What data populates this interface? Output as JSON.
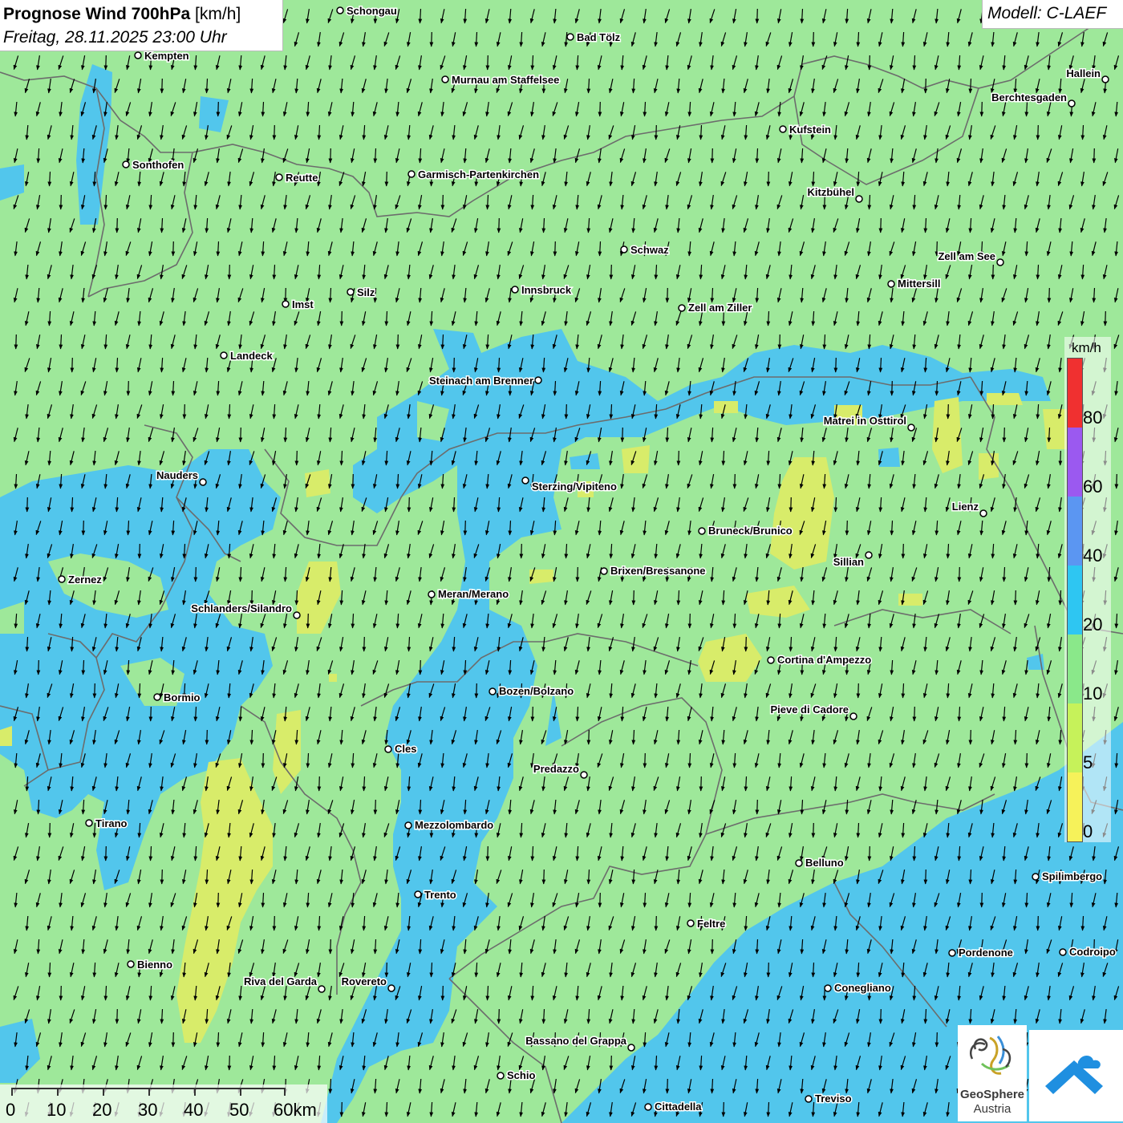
{
  "header": {
    "title_bold": "Prognose Wind 700hPa",
    "title_unit": "[km/h]",
    "datetime": "Freitag, 28.11.2025 23:00 Uhr"
  },
  "model": {
    "label": "Modell: C-LAEF"
  },
  "legend": {
    "unit": "km/h",
    "ticks": [
      "80",
      "60",
      "40",
      "20",
      "10",
      "5",
      "0"
    ],
    "classes": [
      {
        "range": "80+",
        "color": "#f03030"
      },
      {
        "range": "60-80",
        "color": "#9b59f0"
      },
      {
        "range": "40-60",
        "color": "#5b96f2"
      },
      {
        "range": "20-40",
        "color": "#2ec6f2"
      },
      {
        "range": "10-20",
        "color": "#8ae88a"
      },
      {
        "range": "5-10",
        "color": "#c6f25a"
      },
      {
        "range": "0-5",
        "color": "#f6f25a"
      }
    ]
  },
  "scalebar": {
    "labels": [
      "0",
      "10",
      "20",
      "30",
      "40",
      "50",
      "60km"
    ]
  },
  "logos": {
    "geosphere_line1": "GeoSphere",
    "geosphere_line2": "Austria"
  },
  "colors": {
    "land_wind_10_20": "#9ee89a",
    "wind_20_40": "#52c6ec",
    "wind_5_10": "#d8ec6a",
    "borders": "#6c6c6c",
    "arrows": "#000000"
  },
  "wind": {
    "prevailing_direction": "north-northwest (arrows pointing south-southeast)"
  },
  "cities": [
    {
      "name": "Schongau"
    },
    {
      "name": "Bad Tölz"
    },
    {
      "name": "Kempten"
    },
    {
      "name": "Murnau am Staffelsee"
    },
    {
      "name": "Hallein"
    },
    {
      "name": "Berchtesgaden"
    },
    {
      "name": "Kufstein"
    },
    {
      "name": "Sonthofen"
    },
    {
      "name": "Reutte"
    },
    {
      "name": "Garmisch-Partenkirchen"
    },
    {
      "name": "Kitzbühel"
    },
    {
      "name": "Schwaz"
    },
    {
      "name": "Zell am See"
    },
    {
      "name": "Mittersill"
    },
    {
      "name": "Silz"
    },
    {
      "name": "Innsbruck"
    },
    {
      "name": "Imst"
    },
    {
      "name": "Zell am Ziller"
    },
    {
      "name": "Landeck"
    },
    {
      "name": "Steinach am Brenner"
    },
    {
      "name": "Matrei in Osttirol"
    },
    {
      "name": "Nauders"
    },
    {
      "name": "Sterzing/Vipiteno"
    },
    {
      "name": "Lienz"
    },
    {
      "name": "Bruneck/Brunico"
    },
    {
      "name": "Sillian"
    },
    {
      "name": "Zernez"
    },
    {
      "name": "Brixen/Bressanone"
    },
    {
      "name": "Meran/Merano"
    },
    {
      "name": "Schlanders/Silandro"
    },
    {
      "name": "Cortina d'Ampezzo"
    },
    {
      "name": "Bormio"
    },
    {
      "name": "Bozen/Bolzano"
    },
    {
      "name": "Pieve di Cadore"
    },
    {
      "name": "Cles"
    },
    {
      "name": "Predazzo"
    },
    {
      "name": "Tirano"
    },
    {
      "name": "Mezzolombardo"
    },
    {
      "name": "Belluno"
    },
    {
      "name": "Spilimbergo"
    },
    {
      "name": "Trento"
    },
    {
      "name": "Feltre"
    },
    {
      "name": "Pordenone"
    },
    {
      "name": "Codroipo"
    },
    {
      "name": "Bienno"
    },
    {
      "name": "Riva del Garda"
    },
    {
      "name": "Rovereto"
    },
    {
      "name": "Conegliano"
    },
    {
      "name": "Bassano del Grappa"
    },
    {
      "name": "Schio"
    },
    {
      "name": "Treviso"
    },
    {
      "name": "Cittadella"
    }
  ]
}
